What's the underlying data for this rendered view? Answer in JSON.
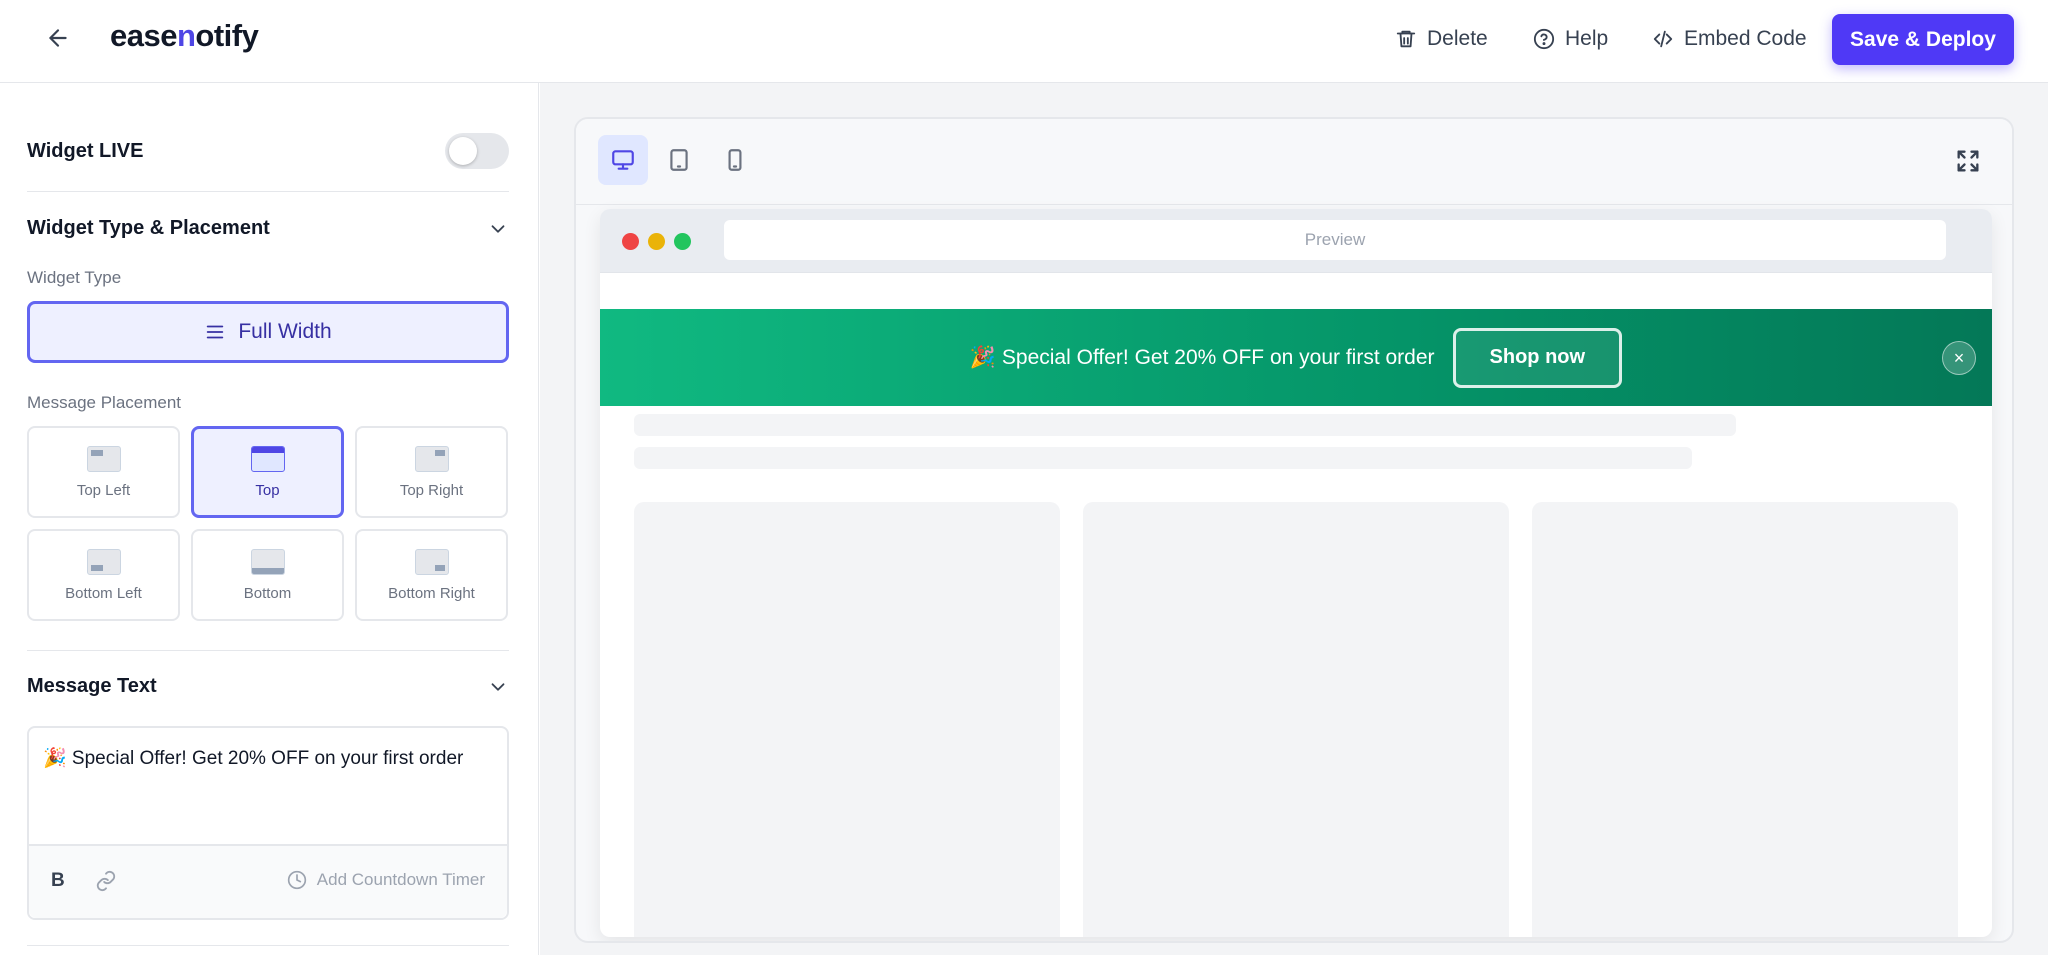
{
  "app": {
    "logo_prefix": "ease",
    "logo_accent": "n",
    "logo_suffix": "otify"
  },
  "toolbar": {
    "back_icon": "arrow-left-icon",
    "delete_label": "Delete",
    "help_label": "Help",
    "embed_label": "Embed Code",
    "deploy_label": "Save & Deploy"
  },
  "sidebar": {
    "widget_live_label": "Widget LIVE",
    "widget_live_on": false,
    "type_section_title": "Widget Type & Placement",
    "widget_type_label": "Widget Type",
    "widget_type_value": "Full Width",
    "placement_label": "Message Placement",
    "placements": [
      {
        "label": "Top Left",
        "active": false
      },
      {
        "label": "Top",
        "active": true
      },
      {
        "label": "Top Right",
        "active": false
      },
      {
        "label": "Bottom Left",
        "active": false
      },
      {
        "label": "Bottom",
        "active": false
      },
      {
        "label": "Bottom Right",
        "active": false
      }
    ],
    "message_section_title": "Message Text",
    "message_text": "🎉 Special Offer! Get 20% OFF on your first order",
    "bold_label": "B",
    "timer_label": "Add Countdown Timer"
  },
  "preview": {
    "devices": [
      "desktop",
      "tablet",
      "mobile"
    ],
    "active_device": "desktop",
    "address_text": "Preview",
    "banner_text": "🎉 Special Offer! Get 20% OFF on your first order",
    "banner_cta": "Shop now",
    "banner_close": "×"
  },
  "colors": {
    "accent": "#4f39f6",
    "banner_start": "#10b981",
    "banner_end": "#047857"
  }
}
